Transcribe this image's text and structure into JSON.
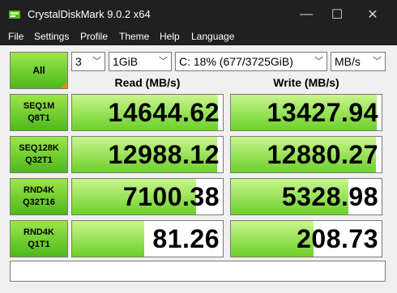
{
  "window": {
    "title": "CrystalDiskMark 9.0.2 x64"
  },
  "controls": {
    "minimize": "—",
    "maximize": "☐",
    "close": "✕"
  },
  "menu": [
    "File",
    "Settings",
    "Profile",
    "Theme",
    "Help",
    "Language"
  ],
  "test": {
    "all_label": "All",
    "count": "3",
    "size": "1GiB",
    "drive": "C: 18% (677/3725GiB)",
    "unit": "MB/s"
  },
  "headers": {
    "read": "Read (MB/s)",
    "write": "Write (MB/s)"
  },
  "rows": [
    {
      "line1": "SEQ1M",
      "line2": "Q8T1",
      "read": "14644.62",
      "write": "13427.94",
      "read_fill": 0.97,
      "write_fill": 0.97
    },
    {
      "line1": "SEQ128K",
      "line2": "Q32T1",
      "read": "12988.12",
      "write": "12880.27",
      "read_fill": 0.96,
      "write_fill": 0.96
    },
    {
      "line1": "RND4K",
      "line2": "Q32T16",
      "read": "7100.38",
      "write": "5328.98",
      "read_fill": 0.82,
      "write_fill": 0.78
    },
    {
      "line1": "RND4K",
      "line2": "Q1T1",
      "read": "81.26",
      "write": "208.73",
      "read_fill": 0.48,
      "write_fill": 0.55
    }
  ],
  "comment": "",
  "colors": {
    "accent_green": "#6cd12a",
    "corner_orange": "#f08a00"
  }
}
